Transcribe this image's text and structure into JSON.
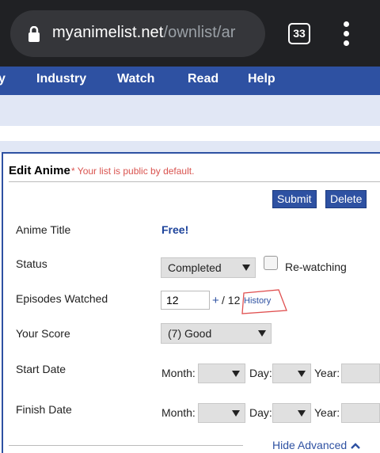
{
  "browser": {
    "url_host": "myanimelist.net",
    "url_path": "/ownlist/ar",
    "tab_count": "33",
    "icons": {
      "lock": "lock-icon",
      "tabs": "tabs-icon",
      "menu": "kebab-menu-icon"
    }
  },
  "nav": {
    "items": [
      "y",
      "Industry",
      "Watch",
      "Read",
      "Help"
    ]
  },
  "edit": {
    "title": "Edit Anime",
    "note": "* Your list is public by default.",
    "submit_label": "Submit",
    "delete_label": "Delete"
  },
  "form": {
    "anime_title_label": "Anime Title",
    "anime_title_value": "Free!",
    "status_label": "Status",
    "status_value": "Completed",
    "rewatching_label": "Re-watching",
    "episodes_label": "Episodes Watched",
    "episodes_value": "12",
    "episodes_plus": "+",
    "episodes_total": "/ 12",
    "history_link": "History",
    "score_label": "Your Score",
    "score_value": "(7) Good",
    "start_label": "Start Date",
    "finish_label": "Finish Date",
    "month_label": "Month:",
    "day_label": "Day:",
    "year_label": "Year:",
    "hide_advanced": "Hide Advanced"
  },
  "colors": {
    "nav_blue": "#2e51a2",
    "chrome_dark": "#202124",
    "note_red": "#d9534f"
  }
}
